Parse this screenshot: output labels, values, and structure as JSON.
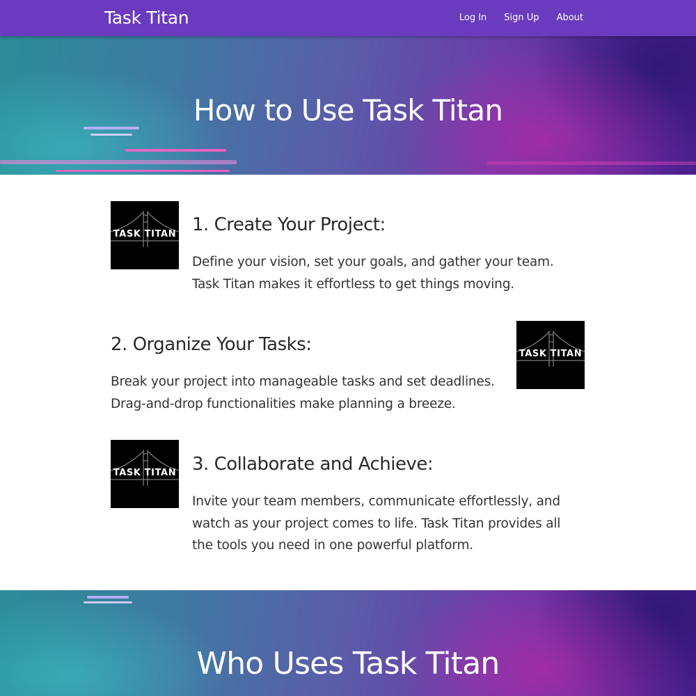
{
  "navbar": {
    "brand": "Task Titan",
    "links": [
      {
        "label": "Log In"
      },
      {
        "label": "Sign Up"
      },
      {
        "label": "About"
      }
    ],
    "color": "#6a3bbf"
  },
  "hero": {
    "title": "How to Use Task Titan"
  },
  "steps": [
    {
      "logo_text": "TASK TITAN",
      "heading": "1. Create Your Project:",
      "body": "Define your vision, set your goals, and gather your team. Task Titan makes it effortless to get things moving."
    },
    {
      "logo_text": "TASK TITAN",
      "heading": "2. Organize Your Tasks:",
      "body": "Break your project into manageable tasks and set deadlines. Drag-and-drop functionalities make planning a breeze."
    },
    {
      "logo_text": "TASK TITAN",
      "heading": "3. Collaborate and Achieve:",
      "body": "Invite your team members, communicate effortlessly, and watch as your project comes to life. Task Titan provides all the tools you need in one powerful platform."
    }
  ],
  "section2": {
    "title": "Who Uses Task Titan"
  }
}
